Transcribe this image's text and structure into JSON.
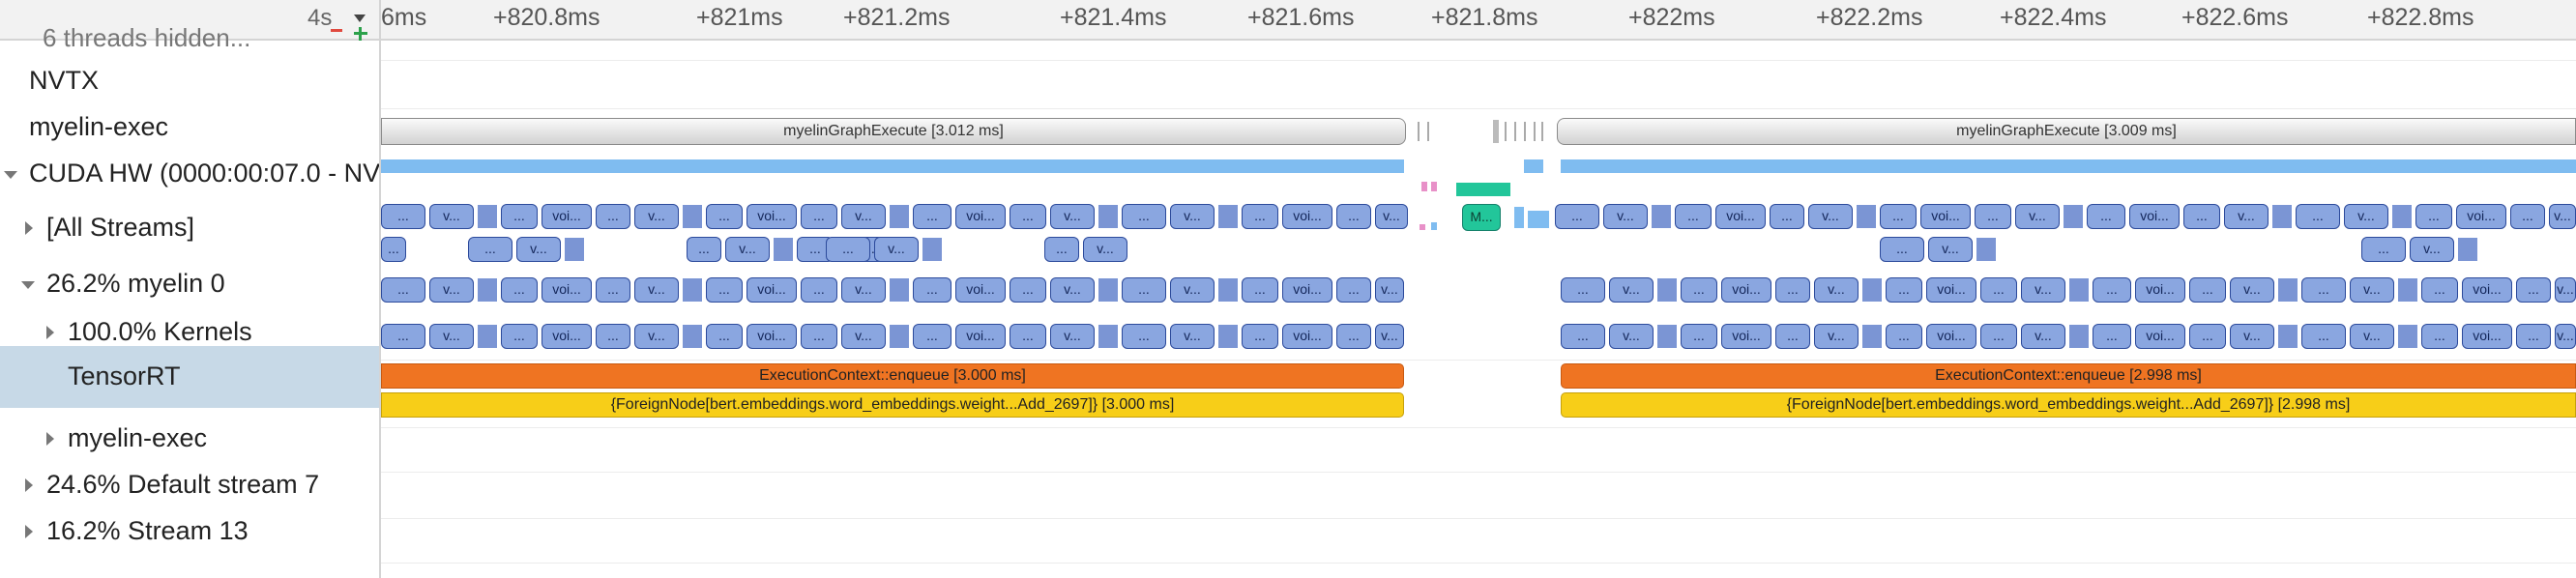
{
  "zoom": {
    "label": "4s"
  },
  "hidden_threads": {
    "label": "6 threads hidden..."
  },
  "tree": [
    {
      "label": "NVTX",
      "name": "tree-row-nvtx",
      "arrow": "none",
      "selected": false
    },
    {
      "label": "myelin-exec",
      "name": "tree-row-myelin-exec-nvtx",
      "arrow": "none",
      "selected": false
    },
    {
      "label": "CUDA HW (0000:00:07.0 - NV",
      "name": "tree-row-cuda-hw",
      "arrow": "down",
      "selected": false
    },
    {
      "label": "[All Streams]",
      "name": "tree-row-all-streams",
      "arrow": "right",
      "selected": false
    },
    {
      "label": "26.2% myelin 0",
      "name": "tree-row-myelin-0",
      "arrow": "down",
      "selected": false
    },
    {
      "label": "100.0% Kernels",
      "name": "tree-row-kernels",
      "arrow": "right",
      "selected": false
    },
    {
      "label": "TensorRT",
      "name": "tree-row-tensorrt",
      "arrow": "none",
      "selected": true
    },
    {
      "label": "myelin-exec",
      "name": "tree-row-myelin-exec",
      "arrow": "right",
      "selected": false
    },
    {
      "label": "24.6% Default stream 7",
      "name": "tree-row-default-stream-7",
      "arrow": "right",
      "selected": false
    },
    {
      "label": "16.2% Stream 13",
      "name": "tree-row-stream-13",
      "arrow": "right",
      "selected": false
    }
  ],
  "ruler": {
    "ticks": [
      "6ms",
      "+820.8ms",
      "+821ms",
      "+821.2ms",
      "+821.4ms",
      "+821.6ms",
      "+821.8ms",
      "+822ms",
      "+822.2ms",
      "+822.4ms",
      "+822.6ms",
      "+822.8ms"
    ]
  },
  "nvtx": {
    "graph_execute_1": "myelinGraphExecute  [3.012 ms]",
    "graph_execute_2": "myelinGraphExecute  [3.009 ms]"
  },
  "tensorrt": {
    "enqueue_1": "ExecutionContext::enqueue [3.000 ms]",
    "enqueue_2": "ExecutionContext::enqueue [2.998 ms]",
    "foreign_1": "{ForeignNode[bert.embeddings.word_embeddings.weight...Add_2697]} [3.000 ms]",
    "foreign_2": "{ForeignNode[bert.embeddings.word_embeddings.weight...Add_2697]} [2.998 ms]"
  },
  "kernel_labels": {
    "short": "v...",
    "medium": "voi...",
    "ellipsis": "...",
    "mid_green": "M..."
  },
  "colors": {
    "kernel": "#8aa6e0",
    "memory": "#7fbcf0",
    "orange": "#ef7422",
    "yellow": "#f7ce18",
    "green": "#22c69a",
    "selection": "#c7d9e7"
  }
}
